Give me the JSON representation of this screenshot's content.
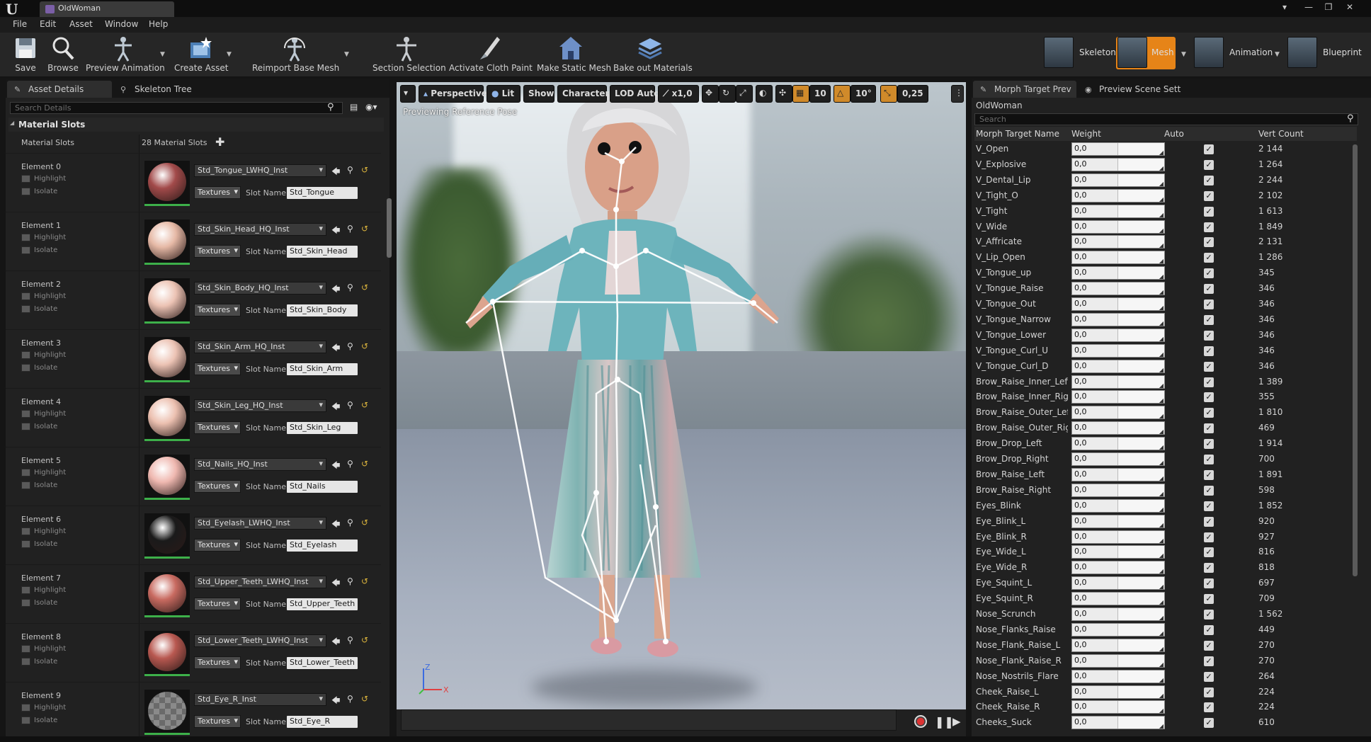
{
  "window": {
    "tab_title": "OldWoman",
    "logo": "U",
    "controls": [
      "▾",
      "—",
      "❐",
      "✕"
    ]
  },
  "menu": [
    "File",
    "Edit",
    "Asset",
    "Window",
    "Help"
  ],
  "toolbar": {
    "items": [
      {
        "label": "Save",
        "icon": "save-icon"
      },
      {
        "label": "Browse",
        "icon": "browse-icon"
      },
      {
        "label": "Preview Animation",
        "icon": "preview-animation-icon"
      },
      {
        "label": "Create Asset",
        "icon": "create-asset-icon"
      },
      {
        "label": "Reimport Base Mesh",
        "icon": "reimport-icon"
      },
      {
        "label": "Section Selection",
        "icon": "section-selection-icon"
      },
      {
        "label": "Activate Cloth Paint",
        "icon": "cloth-paint-icon"
      },
      {
        "label": "Make Static Mesh",
        "icon": "static-mesh-icon"
      },
      {
        "label": "Bake out Materials",
        "icon": "bake-materials-icon"
      }
    ],
    "modes": [
      {
        "label": "Skeleton",
        "active": false
      },
      {
        "label": "Mesh",
        "active": true
      },
      {
        "label": "Animation",
        "active": false
      },
      {
        "label": "Blueprint",
        "active": false
      }
    ],
    "accent": "#e68418"
  },
  "left_panel": {
    "tabs": [
      "Asset Details",
      "Skeleton Tree"
    ],
    "search_placeholder": "Search Details",
    "category": "Material Slots",
    "slots_label": "Material Slots",
    "slots_count": "28 Material Slots",
    "highlight_label": "Highlight",
    "isolate_label": "Isolate",
    "textures_label": "Textures",
    "slot_name_label": "Slot Name",
    "elements": [
      {
        "name": "Element 0",
        "material": "Std_Tongue_LWHQ_Inst",
        "slot": "Std_Tongue",
        "color": "#a24a4a"
      },
      {
        "name": "Element 1",
        "material": "Std_Skin_Head_HQ_Inst",
        "slot": "Std_Skin_Head",
        "color": "#e6b9a6"
      },
      {
        "name": "Element 2",
        "material": "Std_Skin_Body_HQ_Inst",
        "slot": "Std_Skin_Body",
        "color": "#ecc3b4"
      },
      {
        "name": "Element 3",
        "material": "Std_Skin_Arm_HQ_Inst",
        "slot": "Std_Skin_Arm",
        "color": "#ecc3b4"
      },
      {
        "name": "Element 4",
        "material": "Std_Skin_Leg_HQ_Inst",
        "slot": "Std_Skin_Leg",
        "color": "#ecc0b0"
      },
      {
        "name": "Element 5",
        "material": "Std_Nails_HQ_Inst",
        "slot": "Std_Nails",
        "color": "#efb8b0"
      },
      {
        "name": "Element 6",
        "material": "Std_Eyelash_LWHQ_Inst",
        "slot": "Std_Eyelash",
        "color": "#1a1a1a"
      },
      {
        "name": "Element 7",
        "material": "Std_Upper_Teeth_LWHQ_Inst",
        "slot": "Std_Upper_Teeth",
        "color": "#c86a60"
      },
      {
        "name": "Element 8",
        "material": "Std_Lower_Teeth_LWHQ_Inst",
        "slot": "Std_Lower_Teeth",
        "color": "#b85850"
      },
      {
        "name": "Element 9",
        "material": "Std_Eye_R_Inst",
        "slot": "Std_Eye_R",
        "color": "#777777"
      }
    ]
  },
  "viewport": {
    "buttons": [
      "Perspective",
      "Lit",
      "Show",
      "Character",
      "LOD Auto"
    ],
    "scale": "x1,0",
    "grid_snap": "10",
    "rotation_snap": "10°",
    "scale_snap": "0,25",
    "note": "Previewing Reference Pose",
    "axis_z": "Z",
    "axis_x": "X"
  },
  "right_panel": {
    "tabs": [
      "Morph Target Prev",
      "Preview Scene Sett"
    ],
    "owner": "OldWoman",
    "search_placeholder": "Search",
    "columns": [
      "Morph Target Name",
      "Weight",
      "Auto",
      "Vert Count"
    ],
    "checkmark": "✓",
    "rows": [
      {
        "name": "V_Open",
        "weight": "0,0",
        "verts": "2 144"
      },
      {
        "name": "V_Explosive",
        "weight": "0,0",
        "verts": "1 264"
      },
      {
        "name": "V_Dental_Lip",
        "weight": "0,0",
        "verts": "2 244"
      },
      {
        "name": "V_Tight_O",
        "weight": "0,0",
        "verts": "2 102"
      },
      {
        "name": "V_Tight",
        "weight": "0,0",
        "verts": "1 613"
      },
      {
        "name": "V_Wide",
        "weight": "0,0",
        "verts": "1 849"
      },
      {
        "name": "V_Affricate",
        "weight": "0,0",
        "verts": "2 131"
      },
      {
        "name": "V_Lip_Open",
        "weight": "0,0",
        "verts": "1 286"
      },
      {
        "name": "V_Tongue_up",
        "weight": "0,0",
        "verts": "345"
      },
      {
        "name": "V_Tongue_Raise",
        "weight": "0,0",
        "verts": "346"
      },
      {
        "name": "V_Tongue_Out",
        "weight": "0,0",
        "verts": "346"
      },
      {
        "name": "V_Tongue_Narrow",
        "weight": "0,0",
        "verts": "346"
      },
      {
        "name": "V_Tongue_Lower",
        "weight": "0,0",
        "verts": "346"
      },
      {
        "name": "V_Tongue_Curl_U",
        "weight": "0,0",
        "verts": "346"
      },
      {
        "name": "V_Tongue_Curl_D",
        "weight": "0,0",
        "verts": "346"
      },
      {
        "name": "Brow_Raise_Inner_Left",
        "weight": "0,0",
        "verts": "1 389"
      },
      {
        "name": "Brow_Raise_Inner_Right",
        "weight": "0,0",
        "verts": "355"
      },
      {
        "name": "Brow_Raise_Outer_Left",
        "weight": "0,0",
        "verts": "1 810"
      },
      {
        "name": "Brow_Raise_Outer_Right",
        "weight": "0,0",
        "verts": "469"
      },
      {
        "name": "Brow_Drop_Left",
        "weight": "0,0",
        "verts": "1 914"
      },
      {
        "name": "Brow_Drop_Right",
        "weight": "0,0",
        "verts": "700"
      },
      {
        "name": "Brow_Raise_Left",
        "weight": "0,0",
        "verts": "1 891"
      },
      {
        "name": "Brow_Raise_Right",
        "weight": "0,0",
        "verts": "598"
      },
      {
        "name": "Eyes_Blink",
        "weight": "0,0",
        "verts": "1 852"
      },
      {
        "name": "Eye_Blink_L",
        "weight": "0,0",
        "verts": "920"
      },
      {
        "name": "Eye_Blink_R",
        "weight": "0,0",
        "verts": "927"
      },
      {
        "name": "Eye_Wide_L",
        "weight": "0,0",
        "verts": "816"
      },
      {
        "name": "Eye_Wide_R",
        "weight": "0,0",
        "verts": "818"
      },
      {
        "name": "Eye_Squint_L",
        "weight": "0,0",
        "verts": "697"
      },
      {
        "name": "Eye_Squint_R",
        "weight": "0,0",
        "verts": "709"
      },
      {
        "name": "Nose_Scrunch",
        "weight": "0,0",
        "verts": "1 562"
      },
      {
        "name": "Nose_Flanks_Raise",
        "weight": "0,0",
        "verts": "449"
      },
      {
        "name": "Nose_Flank_Raise_L",
        "weight": "0,0",
        "verts": "270"
      },
      {
        "name": "Nose_Flank_Raise_R",
        "weight": "0,0",
        "verts": "270"
      },
      {
        "name": "Nose_Nostrils_Flare",
        "weight": "0,0",
        "verts": "264"
      },
      {
        "name": "Cheek_Raise_L",
        "weight": "0,0",
        "verts": "224"
      },
      {
        "name": "Cheek_Raise_R",
        "weight": "0,0",
        "verts": "224"
      },
      {
        "name": "Cheeks_Suck",
        "weight": "0,0",
        "verts": "610"
      }
    ]
  }
}
